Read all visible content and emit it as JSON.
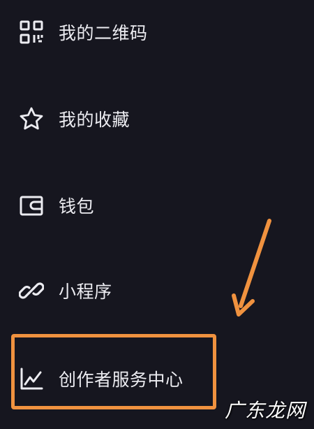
{
  "menu": {
    "items": [
      {
        "label": "我的二维码",
        "icon": "qr-code-icon"
      },
      {
        "label": "我的收藏",
        "icon": "star-icon"
      },
      {
        "label": "钱包",
        "icon": "wallet-icon"
      },
      {
        "label": "小程序",
        "icon": "link-icon"
      },
      {
        "label": "创作者服务中心",
        "icon": "chart-line-icon"
      }
    ]
  },
  "annotation": {
    "highlight_color": "#f0923f",
    "target": "创作者服务中心"
  },
  "watermark": {
    "text": "广东龙网"
  },
  "colors": {
    "background": "#16161f",
    "text": "#ececf1",
    "accent": "#f0923f"
  }
}
